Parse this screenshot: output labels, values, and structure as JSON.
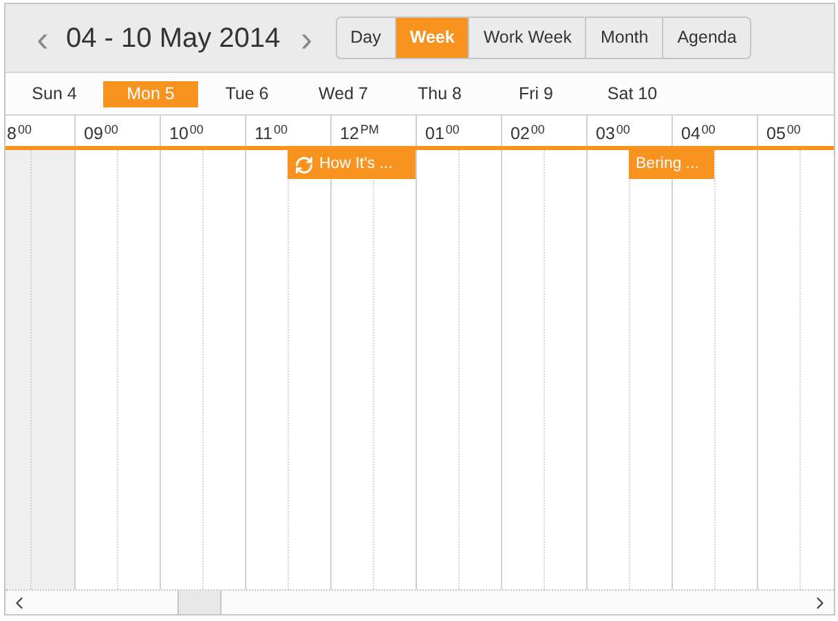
{
  "toolbar": {
    "prev": "‹",
    "range": "04 - 10 May 2014",
    "next": "›",
    "views": [
      {
        "label": "Day",
        "selected": false
      },
      {
        "label": "Week",
        "selected": true
      },
      {
        "label": "Work Week",
        "selected": false
      },
      {
        "label": "Month",
        "selected": false
      },
      {
        "label": "Agenda",
        "selected": false
      }
    ]
  },
  "days": [
    {
      "label": "Sun 4",
      "selected": false
    },
    {
      "label": "Mon 5",
      "selected": true
    },
    {
      "label": "Tue 6",
      "selected": false
    },
    {
      "label": "Wed 7",
      "selected": false
    },
    {
      "label": "Thu 8",
      "selected": false
    },
    {
      "label": "Fri 9",
      "selected": false
    },
    {
      "label": "Sat 10",
      "selected": false
    }
  ],
  "time_slots": [
    {
      "hour": "8",
      "suffix": "00",
      "off_hours": true
    },
    {
      "hour": "09",
      "suffix": "00",
      "off_hours": false
    },
    {
      "hour": "10",
      "suffix": "00",
      "off_hours": false
    },
    {
      "hour": "11",
      "suffix": "00",
      "off_hours": false
    },
    {
      "hour": "12",
      "suffix": "PM",
      "off_hours": false
    },
    {
      "hour": "01",
      "suffix": "00",
      "off_hours": false
    },
    {
      "hour": "02",
      "suffix": "00",
      "off_hours": false
    },
    {
      "hour": "03",
      "suffix": "00",
      "off_hours": false
    },
    {
      "hour": "04",
      "suffix": "00",
      "off_hours": false
    },
    {
      "hour": "05",
      "suffix": "00",
      "off_hours": false
    }
  ],
  "events": [
    {
      "title": "How It's ...",
      "recurring": true
    },
    {
      "title": "Bering ...",
      "recurring": false
    }
  ]
}
